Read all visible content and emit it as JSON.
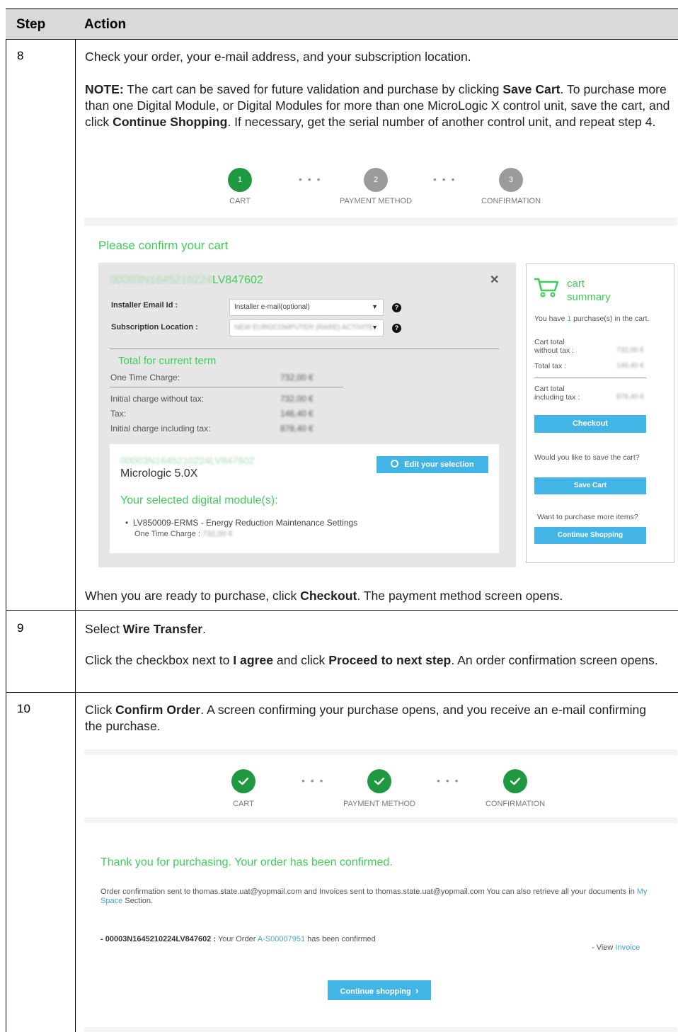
{
  "table": {
    "header_step": "Step",
    "header_action": "Action"
  },
  "step8": {
    "number": "8",
    "line1": "Check your order, your e-mail address, and your subscription location.",
    "note_label": "NOTE:",
    "note_p1": " The cart can be saved for future validation and purchase by clicking ",
    "note_save": "Save Cart",
    "note_p2": ". To purchase more than one Digital Module, or Digital Modules for more than one MicroLogic X control unit, save the cart, and click ",
    "note_continue": "Continue Shopping",
    "note_p3": ". If necessary, get the serial number of another control unit, and repeat step 4.",
    "after_p1": "When you are ready to purchase, click ",
    "after_checkout": "Checkout",
    "after_p2": ". The payment method screen opens."
  },
  "step9": {
    "number": "9",
    "l1_p1": "Select ",
    "l1_wire": "Wire Transfer",
    "l1_p2": ".",
    "l2_p1": "Click the checkbox next to ",
    "l2_agree": "I agree",
    "l2_p2": " and click ",
    "l2_proceed": "Proceed to next step",
    "l2_p3": ". An order confirmation screen opens."
  },
  "step10": {
    "number": "10",
    "l1_p1": "Click ",
    "l1_confirm": "Confirm Order",
    "l1_p2": ". A screen confirming your purchase opens, and you receive an e-mail confirming the purchase."
  },
  "progress": {
    "step1_num": "1",
    "step2_num": "2",
    "step3_num": "3",
    "cart": "CART",
    "payment": "PAYMENT METHOD",
    "confirmation": "CONFIRMATION",
    "dots": "• • •"
  },
  "cart_screen": {
    "heading": "Please confirm your cart",
    "serial_blurred": "00003N1645210224",
    "serial_visible": "LV847602",
    "close": "✕",
    "installer_label": "Installer Email Id :",
    "installer_placeholder": "Installer e-mail(optional)",
    "subscription_label": "Subscription Location :",
    "subscription_value": "NEW EUROCOMPUTER (RARE) ACTIVITE",
    "caret": "▼",
    "help": "?",
    "total_heading": "Total for current term",
    "one_time_label": "One Time Charge:",
    "one_time_value": "732,00 €",
    "initial_wo_tax_label": "Initial charge without tax:",
    "initial_wo_tax_value": "732,00 €",
    "tax_label": "Tax:",
    "tax_value": "146,40 €",
    "initial_inc_tax_label": "Initial charge including tax:",
    "initial_inc_tax_value": "878,40 €",
    "unit_serial": "00003N1645210224LV847602",
    "unit_name": "Micrologic 5.0X",
    "edit_button": "Edit your selection",
    "modules_heading": "Your selected digital module(s):",
    "module_item": "LV850009-ERMS - Energy Reduction Maintenance Settings",
    "module_charge_label": "One Time Charge : ",
    "module_charge_value": "732,00 €"
  },
  "cart_summary": {
    "title_line1": "cart",
    "title_line2": "summary",
    "you_have_p1": "You have ",
    "you_have_count": "1",
    "you_have_p2": " purchase(s) in the cart.",
    "total_wo_tax_label": "Cart total without tax :",
    "total_wo_tax_value": "732,00 €",
    "total_tax_label": "Total tax :",
    "total_tax_value": "146,40 €",
    "total_inc_tax_label": "Cart total including tax :",
    "total_inc_tax_value": "878,40 €",
    "checkout_button": "Checkout",
    "save_question": "Would you like to save the cart?",
    "save_button": "Save Cart",
    "more_question": "Want to purchase more items?",
    "continue_button": "Continue Shopping"
  },
  "confirm_screen": {
    "heading": "Thank you for purchasing. Your order has been confirmed.",
    "sent_p1": "Order confirmation sent to thomas.state.uat@yopmail.com and Invoices sent to thomas.state.uat@yopmail.com You can also retrieve all your documents in ",
    "myspace": "My Space",
    "sent_p2": " Section.",
    "order_serial": "- 00003N1645210224LV847602 :",
    "order_p1": " Your Order ",
    "order_id": "A-S00007951",
    "order_p2": " has been confirmed",
    "view_p1": "- View ",
    "view_invoice": "Invoice",
    "continue_button": "Continue shopping",
    "continue_chevron": "›"
  },
  "colors": {
    "accent_green": "#3dcd58",
    "step_green": "#1f9940",
    "button_blue": "#42b4e6",
    "link_blue": "#42a4d9",
    "header_gray": "#d9d9d9"
  }
}
